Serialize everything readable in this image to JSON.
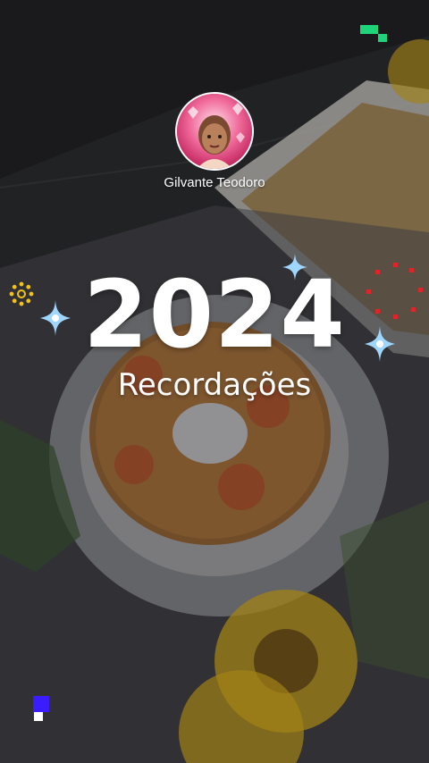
{
  "profile": {
    "username": "Gilvante Teodoro"
  },
  "headline": {
    "year": "2024",
    "subtitle": "Recordações"
  },
  "colors": {
    "text": "#ffffff",
    "accent_green": "#1fd37a",
    "accent_blue": "#3a1cff",
    "accent_red": "#e0242a",
    "accent_yellow": "#f2c316",
    "sparkle": "#9fd6ff"
  },
  "icons": {
    "sparkle": "four-point-star-icon",
    "dots_ring": "dotted-circle-icon",
    "pixel_blocks": "pixel-block-icon"
  }
}
